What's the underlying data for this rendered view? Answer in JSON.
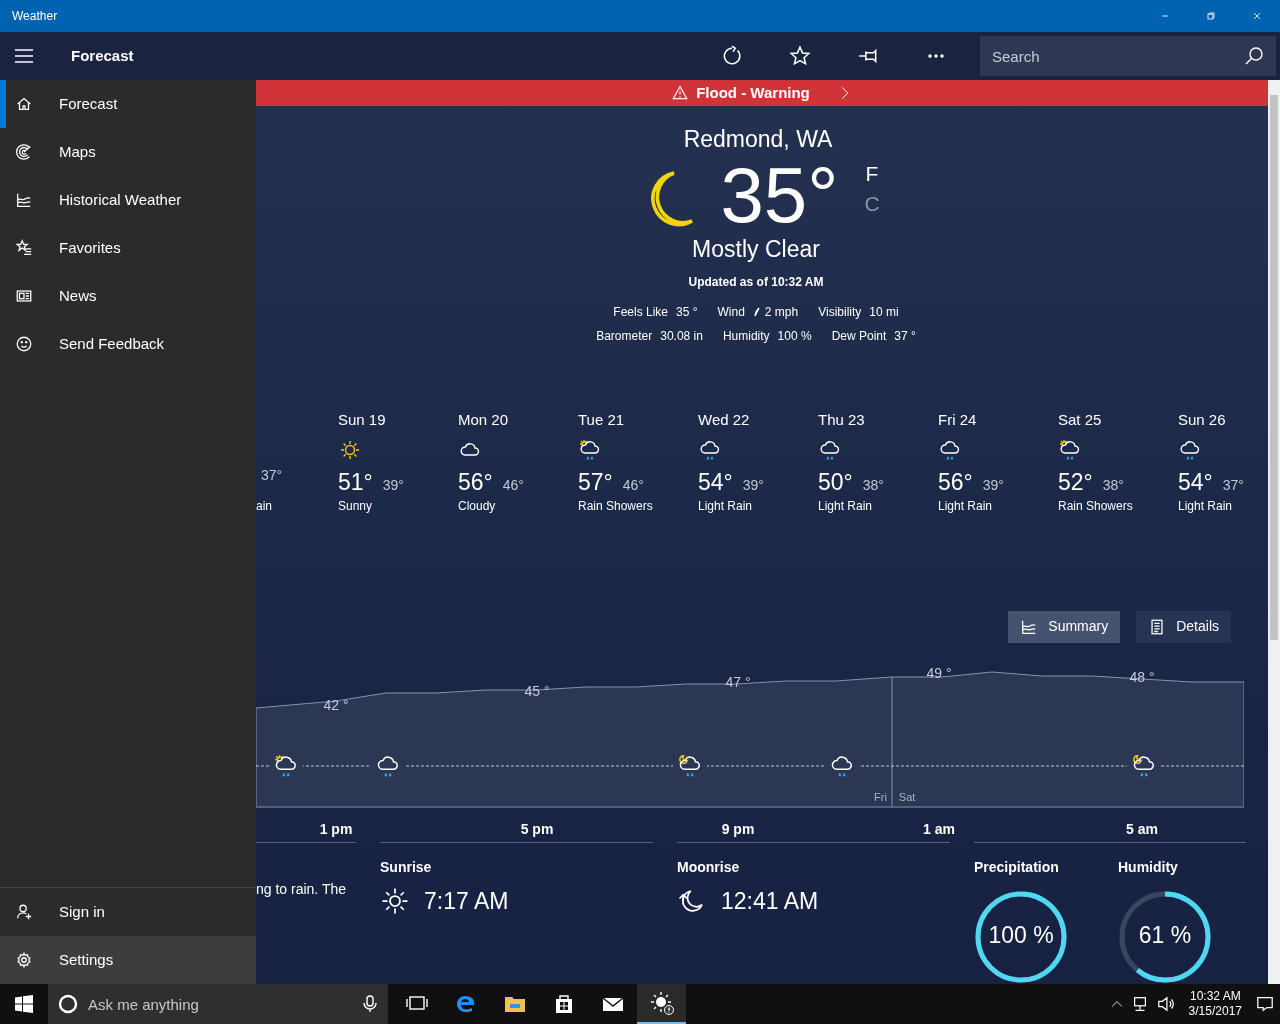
{
  "window": {
    "title": "Weather"
  },
  "header": {
    "title": "Forecast",
    "search": {
      "placeholder": "Search"
    }
  },
  "sidebar": {
    "items": [
      {
        "label": "Forecast",
        "kind": "home",
        "selected": true
      },
      {
        "label": "Maps",
        "kind": "radar",
        "selected": false
      },
      {
        "label": "Historical Weather",
        "kind": "chart",
        "selected": false
      },
      {
        "label": "Favorites",
        "kind": "star-list",
        "selected": false
      },
      {
        "label": "News",
        "kind": "news",
        "selected": false
      },
      {
        "label": "Send Feedback",
        "kind": "smile",
        "selected": false
      }
    ],
    "bottom_items": [
      {
        "label": "Sign in",
        "kind": "person",
        "hovered": false
      },
      {
        "label": "Settings",
        "kind": "gear",
        "hovered": true
      }
    ]
  },
  "alert": {
    "text": "Flood - Warning"
  },
  "current": {
    "location": "Redmond, WA",
    "temperature": "35°",
    "condition": "Mostly Clear",
    "updated": "Updated as of 10:32 AM",
    "units": [
      {
        "label": "F",
        "selected": true
      },
      {
        "label": "C",
        "selected": false
      }
    ],
    "details": [
      [
        {
          "label": "Feels Like",
          "value": "35 °",
          "kind": "plain"
        },
        {
          "label": "Wind",
          "value": "2 mph",
          "kind": "wind"
        },
        {
          "label": "Visibility",
          "value": "10 mi",
          "kind": "plain"
        }
      ],
      [
        {
          "label": "Barometer",
          "value": "30.08 in",
          "kind": "plain"
        },
        {
          "label": "Humidity",
          "value": "100 %",
          "kind": "plain"
        },
        {
          "label": "Dew Point",
          "value": "37 °",
          "kind": "plain"
        }
      ]
    ]
  },
  "daily": [
    {
      "low": "37°",
      "condition": "ain"
    },
    {
      "day": "Sun 19",
      "high": "51°",
      "low": "39°",
      "condition": "Sunny",
      "kind": "sun"
    },
    {
      "day": "Mon 20",
      "high": "56°",
      "low": "46°",
      "condition": "Cloudy",
      "kind": "cloud"
    },
    {
      "day": "Tue 21",
      "high": "57°",
      "low": "46°",
      "condition": "Rain Showers",
      "kind": "sun-rain"
    },
    {
      "day": "Wed 22",
      "high": "54°",
      "low": "39°",
      "condition": "Light Rain",
      "kind": "rain"
    },
    {
      "day": "Thu 23",
      "high": "50°",
      "low": "38°",
      "condition": "Light Rain",
      "kind": "rain"
    },
    {
      "day": "Fri 24",
      "high": "56°",
      "low": "39°",
      "condition": "Light Rain",
      "kind": "rain"
    },
    {
      "day": "Sat 25",
      "high": "52°",
      "low": "38°",
      "condition": "Rain Showers",
      "kind": "sun-rain"
    },
    {
      "day": "Sun 26",
      "high": "54°",
      "low": "37°",
      "condition": "Light Rain",
      "kind": "rain"
    }
  ],
  "view_buttons": [
    {
      "label": "Summary",
      "kind": "chart",
      "selected": true
    },
    {
      "label": "Details",
      "kind": "list",
      "selected": false
    }
  ],
  "hourly": {
    "temps": [
      "42 °",
      "45 °",
      "47 °",
      "49 °",
      "48 °"
    ],
    "times": [
      "1 pm",
      "5 pm",
      "9 pm",
      "1 am",
      "5 am"
    ],
    "day_change": [
      "Fri",
      "Sat"
    ],
    "icons": [
      {
        "kind": "sun-rain"
      },
      {
        "kind": "rain"
      },
      {
        "kind": "moon-rain"
      },
      {
        "kind": "rain"
      },
      {
        "kind": "moon-rain"
      }
    ]
  },
  "summary_text": "ng to rain. The",
  "sun_moon": [
    {
      "label": "Sunrise",
      "value": "7:17 AM",
      "kind": "sunrise"
    },
    {
      "label": "Moonrise",
      "value": "12:41 AM",
      "kind": "moonrise"
    }
  ],
  "gauges": [
    {
      "label": "Precipitation",
      "value": "100 %",
      "level": 1.0
    },
    {
      "label": "Humidity",
      "value": "61 %",
      "level": 0.61
    }
  ],
  "taskbar": {
    "search_placeholder": "Ask me anything",
    "apps": [
      {
        "kind": "task-view",
        "active": false
      },
      {
        "kind": "edge",
        "active": false
      },
      {
        "kind": "folder",
        "active": false
      },
      {
        "kind": "store",
        "active": false
      },
      {
        "kind": "mail",
        "active": false
      },
      {
        "kind": "weather",
        "active": true
      }
    ],
    "time": "10:32 AM",
    "date": "3/15/2017"
  }
}
